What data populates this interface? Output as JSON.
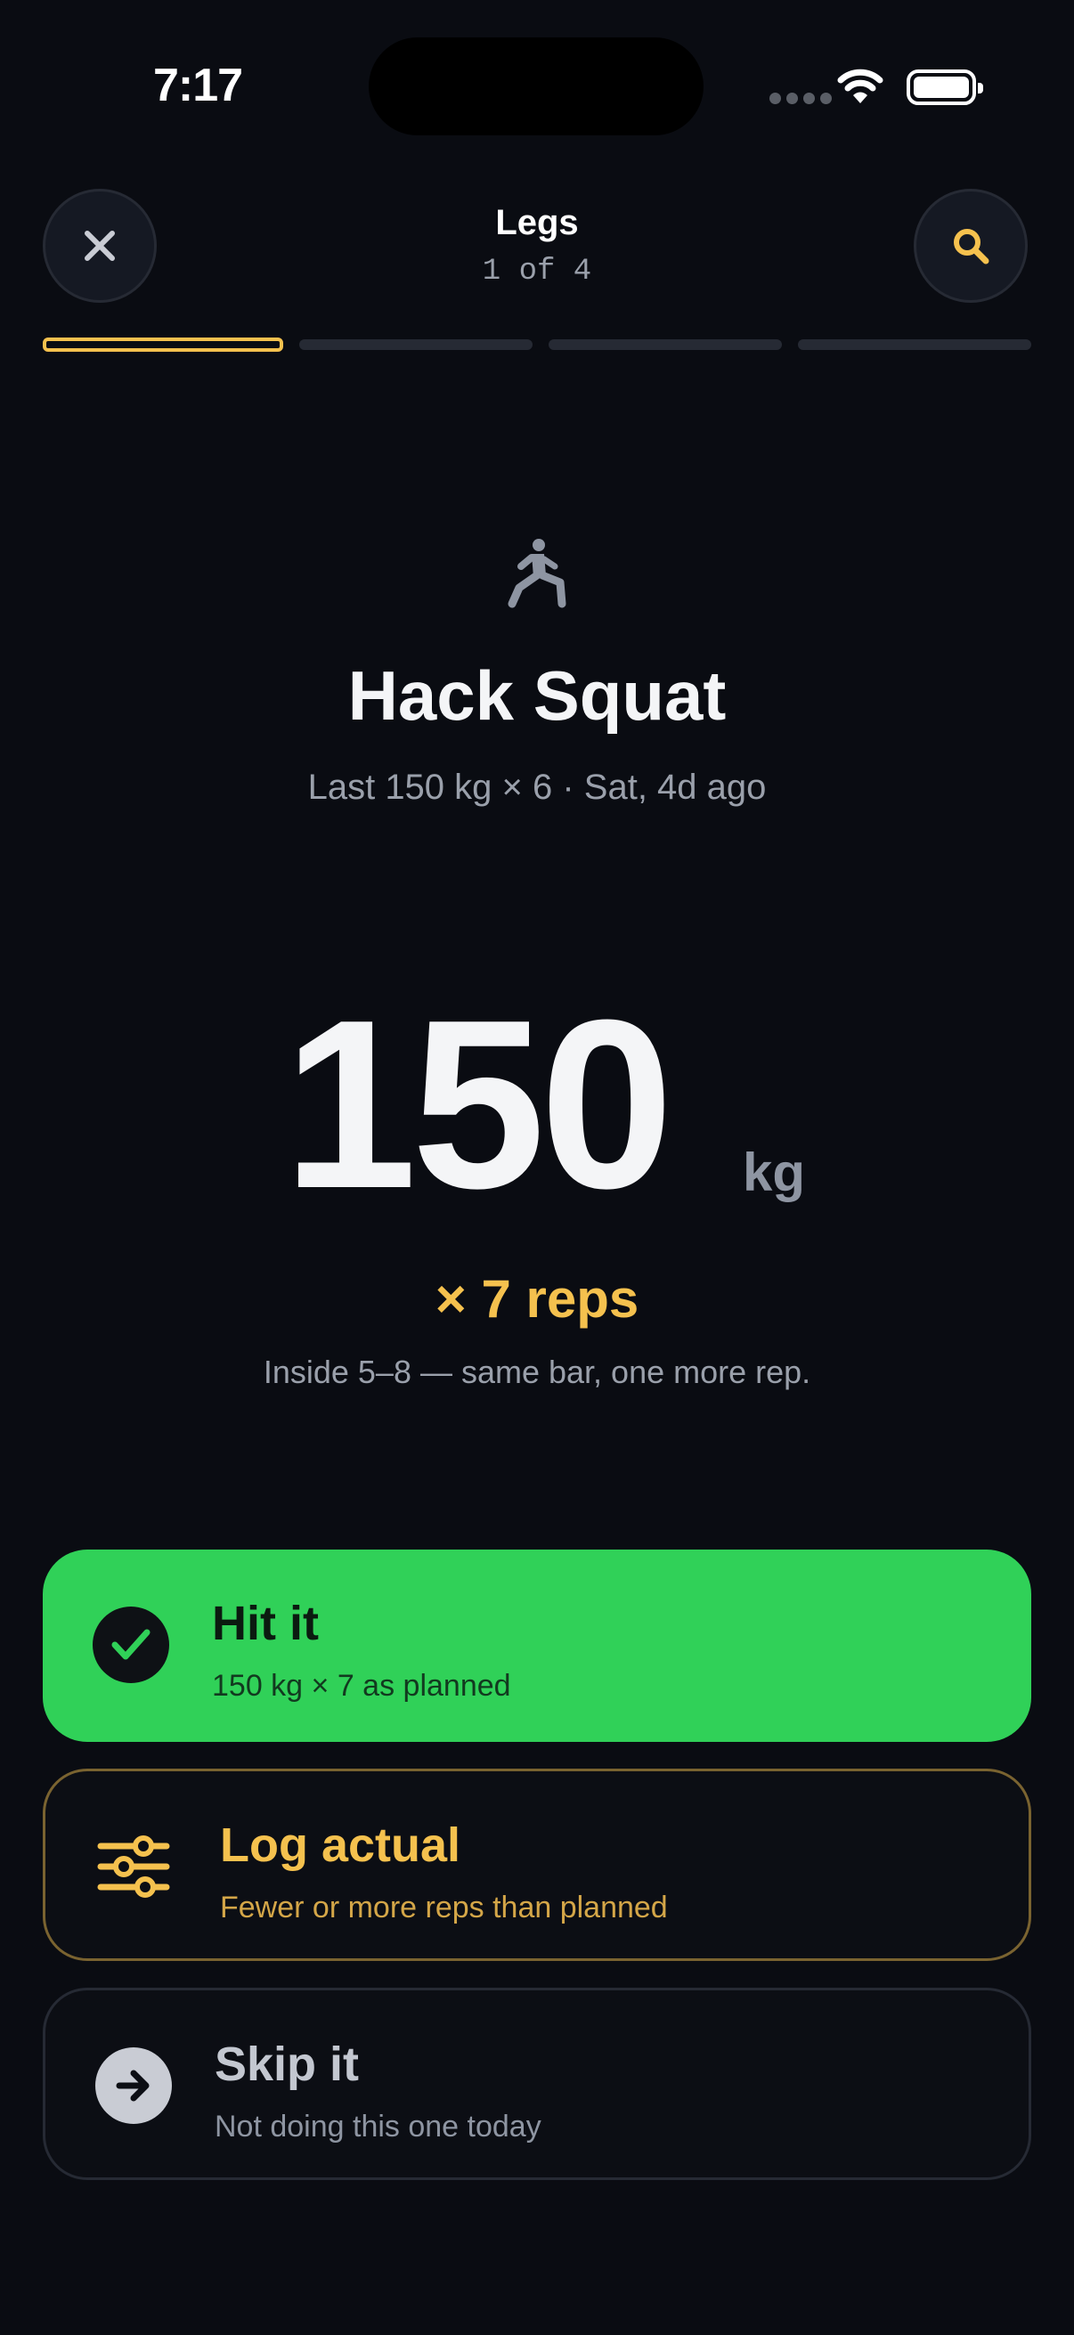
{
  "status_bar": {
    "time": "7:17"
  },
  "header": {
    "title": "Legs",
    "subtitle": "1 of 4",
    "close_icon": "close-icon",
    "search_icon": "search-icon",
    "progress": {
      "total": 4,
      "current": 1
    }
  },
  "exercise": {
    "icon": "lunge-figure-icon",
    "name": "Hack Squat",
    "last": "Last 150 kg × 6 · Sat, 4d ago"
  },
  "target": {
    "weight": "150",
    "unit": "kg",
    "reps": "× 7 reps",
    "note": "Inside 5–8 — same bar, one more rep."
  },
  "actions": [
    {
      "title": "Hit it",
      "subtitle": "150 kg × 7 as planned",
      "icon": "check-icon",
      "color": "#30d158"
    },
    {
      "title": "Log actual",
      "subtitle": "Fewer or more reps than planned",
      "icon": "sliders-icon",
      "color": "#f5c14e"
    },
    {
      "title": "Skip it",
      "subtitle": "Not doing this one today",
      "icon": "arrow-right-icon",
      "color": "#c9ccd4"
    }
  ],
  "colors": {
    "background": "#0a0c12",
    "accent": "#f5c14e",
    "success": "#30d158"
  }
}
